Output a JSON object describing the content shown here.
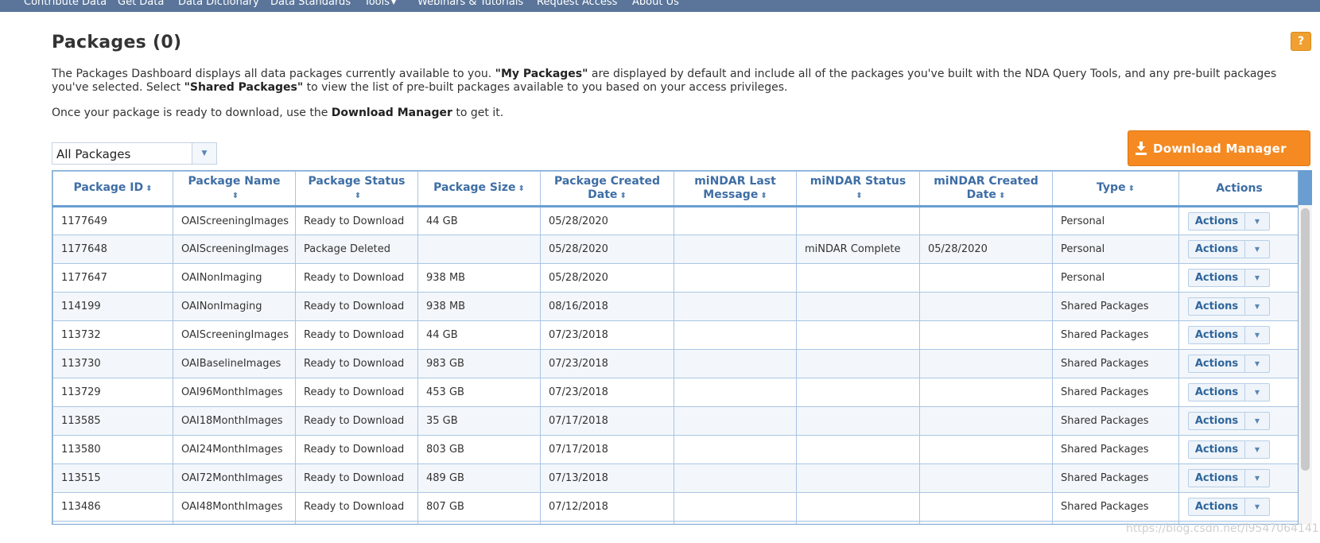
{
  "nav": {
    "items": [
      "Contribute Data",
      "Get Data",
      "Data Dictionary",
      "Data Standards",
      "Tools",
      "Webinars & Tutorials",
      "Request Access",
      "About Us"
    ]
  },
  "page": {
    "title": "Packages (0)",
    "help": "?",
    "intro_part1": "The Packages Dashboard displays all data packages currently available to you.",
    "intro_my_packages": "\"My Packages\"",
    "intro_part2": "are displayed by default and include all of the packages you've built with the NDA Query Tools, and any pre-built packages you've selected. Select",
    "intro_shared_packages": "\"Shared Packages\"",
    "intro_part3": "to view the list of pre-built packages available to you based on your access privileges.",
    "note_part1": "Once your package is ready to download, use the",
    "note_bold": "Download Manager",
    "note_part2": "to get it."
  },
  "filter": {
    "selected": "All Packages"
  },
  "download_manager": {
    "label": "Download Manager",
    "icon": "download-icon"
  },
  "table": {
    "columns": [
      "Package ID",
      "Package Name",
      "Package Status",
      "Package Size",
      "Package Created Date",
      "miNDAR Last Message",
      "miNDAR Status",
      "miNDAR Created Date",
      "Type",
      "Actions"
    ],
    "action_label": "Actions",
    "rows": [
      [
        "1177649",
        "OAIScreeningImages",
        "Ready to Download",
        "44 GB",
        "05/28/2020",
        "",
        "",
        "",
        "Personal"
      ],
      [
        "1177648",
        "OAIScreeningImages",
        "Package Deleted",
        "",
        "05/28/2020",
        "",
        "miNDAR Complete",
        "05/28/2020",
        "Personal"
      ],
      [
        "1177647",
        "OAINonImaging",
        "Ready to Download",
        "938 MB",
        "05/28/2020",
        "",
        "",
        "",
        "Personal"
      ],
      [
        "114199",
        "OAINonImaging",
        "Ready to Download",
        "938 MB",
        "08/16/2018",
        "",
        "",
        "",
        "Shared Packages"
      ],
      [
        "113732",
        "OAIScreeningImages",
        "Ready to Download",
        "44 GB",
        "07/23/2018",
        "",
        "",
        "",
        "Shared Packages"
      ],
      [
        "113730",
        "OAIBaselineImages",
        "Ready to Download",
        "983 GB",
        "07/23/2018",
        "",
        "",
        "",
        "Shared Packages"
      ],
      [
        "113729",
        "OAI96MonthImages",
        "Ready to Download",
        "453 GB",
        "07/23/2018",
        "",
        "",
        "",
        "Shared Packages"
      ],
      [
        "113585",
        "OAI18MonthImages",
        "Ready to Download",
        "35 GB",
        "07/17/2018",
        "",
        "",
        "",
        "Shared Packages"
      ],
      [
        "113580",
        "OAI24MonthImages",
        "Ready to Download",
        "803 GB",
        "07/17/2018",
        "",
        "",
        "",
        "Shared Packages"
      ],
      [
        "113515",
        "OAI72MonthImages",
        "Ready to Download",
        "489 GB",
        "07/13/2018",
        "",
        "",
        "",
        "Shared Packages"
      ],
      [
        "113486",
        "OAI48MonthImages",
        "Ready to Download",
        "807 GB",
        "07/12/2018",
        "",
        "",
        "",
        "Shared Packages"
      ],
      [
        "",
        "",
        "",
        "",
        "",
        "",
        "",
        "",
        ""
      ]
    ]
  },
  "watermark": "https://blog.csdn.net/l9547064141"
}
